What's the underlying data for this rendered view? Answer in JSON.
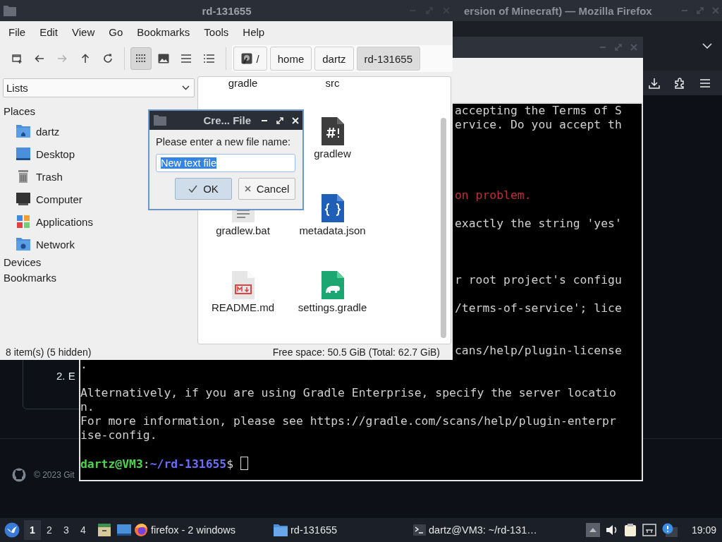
{
  "firefox_window": {
    "title": "ersion of Minecraft) — Mozilla Firefox",
    "page": {
      "list_item": "2. E",
      "footer": "© 2023 Git"
    }
  },
  "terminal_window": {
    "lines": [
      {
        "kind": "cut",
        "text": "accepting the Terms of S"
      },
      {
        "kind": "cut",
        "text": "ervice. Do you accept th"
      },
      {
        "kind": "blank"
      },
      {
        "kind": "blank"
      },
      {
        "kind": "blank"
      },
      {
        "kind": "blank"
      },
      {
        "kind": "cut_error",
        "text": "on problem."
      },
      {
        "kind": "blank"
      },
      {
        "kind": "cut",
        "text": "exactly the string 'yes'"
      },
      {
        "kind": "blank"
      },
      {
        "kind": "blank"
      },
      {
        "kind": "blank"
      },
      {
        "kind": "cut",
        "text": "r root project's configu"
      },
      {
        "kind": "blank"
      },
      {
        "kind": "cut",
        "text": "/terms-of-service'; lice"
      },
      {
        "kind": "blank"
      },
      {
        "kind": "blank"
      },
      {
        "kind": "cut",
        "text": "cans/help/plugin-license"
      },
      {
        "kind": "full",
        "text": "."
      },
      {
        "kind": "blank"
      },
      {
        "kind": "full",
        "text": "Alternatively, if you are using Gradle Enterprise, specify the server locatio"
      },
      {
        "kind": "full",
        "text": "n."
      },
      {
        "kind": "full",
        "text": "For more information, please see https://gradle.com/scans/help/plugin-enterpr"
      },
      {
        "kind": "full",
        "text": "ise-config."
      },
      {
        "kind": "blank"
      }
    ],
    "prompt": {
      "user_host": "dartz@VM3",
      "separator": ":",
      "path": "~/rd-131655",
      "symbol": "$"
    }
  },
  "file_manager": {
    "title": "rd-131655",
    "menu": [
      "File",
      "Edit",
      "View",
      "Go",
      "Bookmarks",
      "Tools",
      "Help"
    ],
    "nav_buttons": [
      {
        "kind": "new-window",
        "disabled": false
      },
      {
        "kind": "back",
        "disabled": false
      },
      {
        "kind": "forward",
        "disabled": true
      },
      {
        "kind": "up",
        "disabled": false
      },
      {
        "kind": "reload",
        "disabled": false
      }
    ],
    "view_buttons": [
      {
        "kind": "icons",
        "selected": true
      },
      {
        "kind": "thumbnails",
        "selected": false
      },
      {
        "kind": "compact",
        "selected": false
      },
      {
        "kind": "details",
        "selected": false
      }
    ],
    "path": [
      {
        "kind": "root",
        "label": "/",
        "selected": false
      },
      {
        "kind": "dir",
        "label": "home",
        "selected": false
      },
      {
        "kind": "dir",
        "label": "dartz",
        "selected": false
      },
      {
        "kind": "dir",
        "label": "rd-131655",
        "selected": true
      }
    ],
    "side_view": "Lists",
    "sections": [
      {
        "title": "Places",
        "items": [
          {
            "kind": "home",
            "label": "dartz"
          },
          {
            "kind": "desktop",
            "label": "Desktop"
          },
          {
            "kind": "trash",
            "label": "Trash"
          },
          {
            "kind": "computer",
            "label": "Computer"
          },
          {
            "kind": "applications",
            "label": "Applications"
          },
          {
            "kind": "network",
            "label": "Network"
          }
        ]
      },
      {
        "title": "Devices"
      },
      {
        "title": "Bookmarks"
      }
    ],
    "files": [
      {
        "kind": "folder",
        "name": "gradle"
      },
      {
        "kind": "folder",
        "name": "src"
      },
      {
        "kind": "script",
        "name": "gradlew"
      },
      {
        "kind": "text",
        "name": "gradlew.bat"
      },
      {
        "kind": "json",
        "name": "metadata.json"
      },
      {
        "kind": "markdown",
        "name": "README.md"
      },
      {
        "kind": "gradle",
        "name": "settings.gradle"
      }
    ],
    "status_left": "8 item(s) (5 hidden)",
    "status_right": "Free space: 50.5 GiB (Total: 62.7 GiB)"
  },
  "dialog": {
    "title": "Cre... File",
    "prompt": "Please enter a new file name:",
    "value": "New text file",
    "value_selected": true,
    "buttons": [
      {
        "kind": "ok",
        "label": "OK",
        "default": true
      },
      {
        "kind": "cancel",
        "label": "Cancel",
        "default": false
      }
    ]
  },
  "taskbar": {
    "workspaces": [
      {
        "label": "1",
        "selected": true
      },
      {
        "label": "2",
        "selected": false
      },
      {
        "label": "3",
        "selected": false
      },
      {
        "label": "4",
        "selected": false
      }
    ],
    "tasks": [
      {
        "kind": "firefox",
        "label": "firefox - 2 windows"
      },
      {
        "kind": "folder",
        "label": "rd-131655"
      },
      {
        "kind": "terminal",
        "label": "dartz@VM3: ~/rd-131…"
      }
    ],
    "clock": "19:09"
  }
}
